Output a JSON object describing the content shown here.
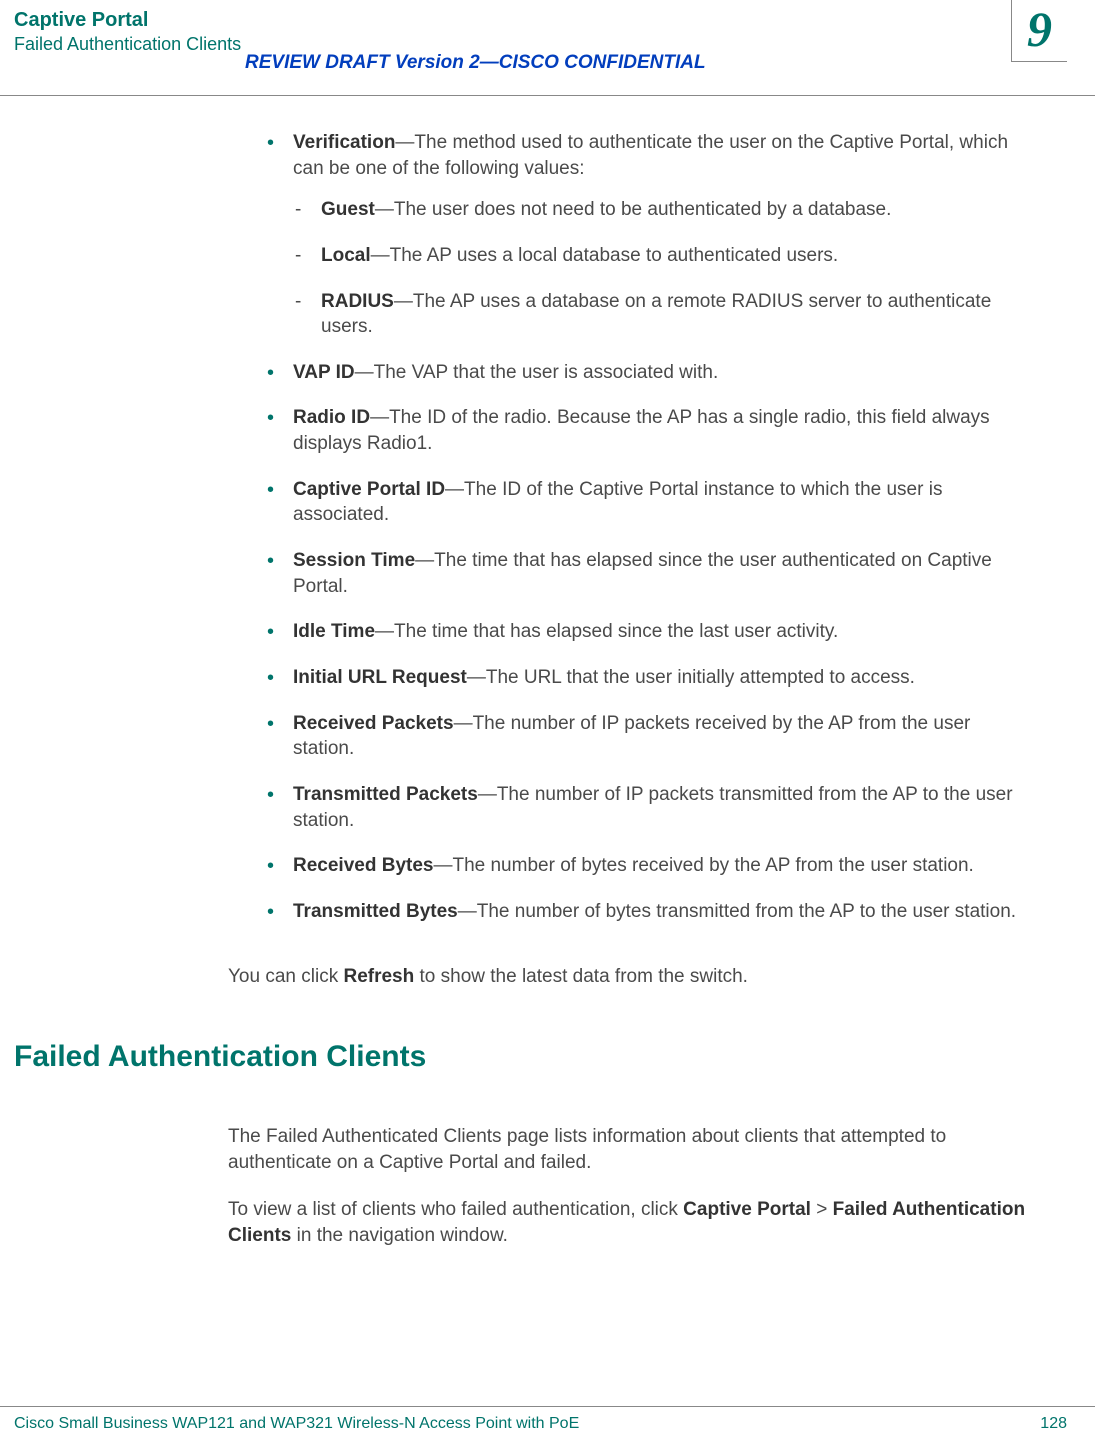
{
  "header": {
    "title": "Captive Portal",
    "subtitle": "Failed Authentication Clients",
    "review": "REVIEW DRAFT  Version 2—CISCO CONFIDENTIAL",
    "chapter": "9"
  },
  "items": {
    "verification": {
      "term": "Verification",
      "desc": "—The method used to authenticate the user on the Captive Portal, which can be one of the following values:",
      "sub": {
        "guest": {
          "term": "Guest",
          "desc": "—The user does not need to be authenticated by a database."
        },
        "local": {
          "term": "Local",
          "desc": "—The AP uses a local database to authenticated users."
        },
        "radius": {
          "term": "RADIUS",
          "desc": "—The AP uses a database on a remote RADIUS server to authenticate users."
        }
      }
    },
    "vapid": {
      "term": "VAP ID",
      "desc": "—The VAP that the user is associated with."
    },
    "radioid": {
      "term": "Radio ID",
      "desc": "—The ID of the radio. Because the AP has a single radio, this field always displays Radio1."
    },
    "cpid": {
      "term": "Captive Portal ID",
      "desc": "—The ID of the Captive Portal instance to which the user is associated."
    },
    "session": {
      "term": "Session Time",
      "desc": "—The time that has elapsed since the user authenticated on Captive Portal."
    },
    "idle": {
      "term": "Idle Time",
      "desc": "—The time that has elapsed since the last user activity."
    },
    "url": {
      "term": "Initial URL Request",
      "desc": "—The URL that the user initially attempted to access."
    },
    "rpkts": {
      "term": "Received Packets",
      "desc": "—The number of IP packets received by the AP from the user station."
    },
    "tpkts": {
      "term": "Transmitted Packets",
      "desc": "—The number of IP packets transmitted from the AP to the user station."
    },
    "rbytes": {
      "term": "Received Bytes",
      "desc": "—The number of bytes received by the AP from the user station."
    },
    "tbytes": {
      "term": "Transmitted Bytes",
      "desc": "—The number of bytes transmitted from the AP to the user station."
    }
  },
  "refreshPara": {
    "pre": "You can click ",
    "bold": "Refresh",
    "post": " to show the latest data from the switch."
  },
  "sectionHead": "Failed Authentication Clients",
  "para1": "The Failed Authenticated Clients page lists information about clients that attempted to authenticate on a Captive Portal and failed.",
  "para2": {
    "pre": "To view a list of clients who failed authentication, click ",
    "b1": "Captive Portal",
    "mid": " > ",
    "b2": "Failed Authentication Clients",
    "post": " in the navigation window."
  },
  "footer": {
    "left": "Cisco Small Business WAP121 and WAP321 Wireless-N Access Point with PoE",
    "right": "128"
  }
}
